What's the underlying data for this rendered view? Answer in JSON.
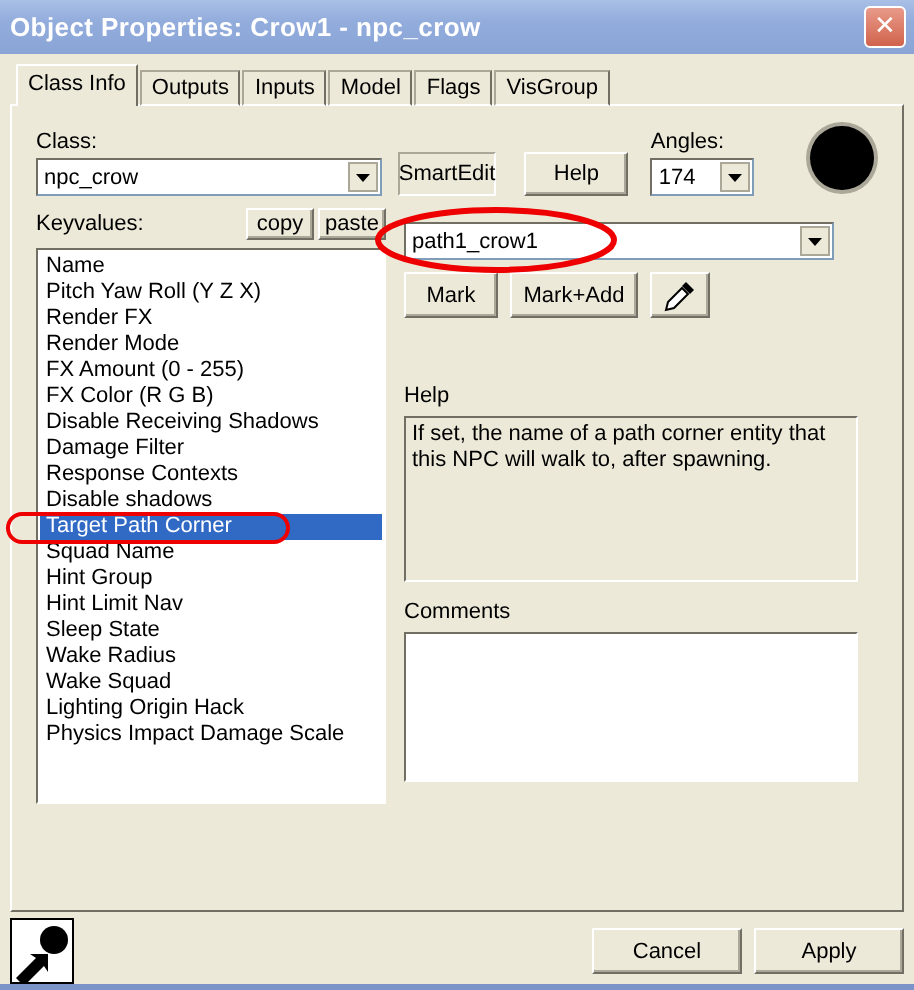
{
  "window": {
    "title": "Object Properties: Crow1 - npc_crow",
    "close": "✕"
  },
  "tabs": [
    {
      "label": "Class Info",
      "selected": true
    },
    {
      "label": "Outputs",
      "selected": false
    },
    {
      "label": "Inputs",
      "selected": false
    },
    {
      "label": "Model",
      "selected": false
    },
    {
      "label": "Flags",
      "selected": false
    },
    {
      "label": "VisGroup",
      "selected": false
    }
  ],
  "class_field": {
    "label": "Class:",
    "value": "npc_crow"
  },
  "top_buttons": [
    "SmartEdit",
    "Help"
  ],
  "angles": {
    "label": "Angles:",
    "value": "174"
  },
  "keyvalues": {
    "label": "Keyvalues:",
    "buttons": [
      "copy",
      "paste"
    ],
    "items": [
      {
        "name": "Name",
        "selected": false
      },
      {
        "name": "Pitch Yaw Roll (Y Z X)",
        "selected": false
      },
      {
        "name": "Render FX",
        "selected": false
      },
      {
        "name": "Render Mode",
        "selected": false
      },
      {
        "name": "FX Amount (0 - 255)",
        "selected": false
      },
      {
        "name": "FX Color (R G B)",
        "selected": false
      },
      {
        "name": "Disable Receiving Shadows",
        "selected": false
      },
      {
        "name": "Damage Filter",
        "selected": false
      },
      {
        "name": "Response Contexts",
        "selected": false
      },
      {
        "name": "Disable shadows",
        "selected": false
      },
      {
        "name": "Target Path Corner",
        "selected": true
      },
      {
        "name": "Squad Name",
        "selected": false
      },
      {
        "name": "Hint Group",
        "selected": false
      },
      {
        "name": "Hint Limit Nav",
        "selected": false
      },
      {
        "name": "Sleep State",
        "selected": false
      },
      {
        "name": "Wake Radius",
        "selected": false
      },
      {
        "name": "Wake Squad",
        "selected": false
      },
      {
        "name": "Lighting Origin Hack",
        "selected": false
      },
      {
        "name": "Physics Impact Damage Scale",
        "selected": false
      }
    ]
  },
  "value_field": {
    "value": "path1_crow1"
  },
  "value_buttons": [
    "Mark",
    "Mark+Add"
  ],
  "help": {
    "label": "Help",
    "text": "If set, the name of a path corner entity that this NPC will walk to, after spawning."
  },
  "comments": {
    "label": "Comments"
  },
  "footer_buttons": [
    "Cancel",
    "Apply"
  ]
}
